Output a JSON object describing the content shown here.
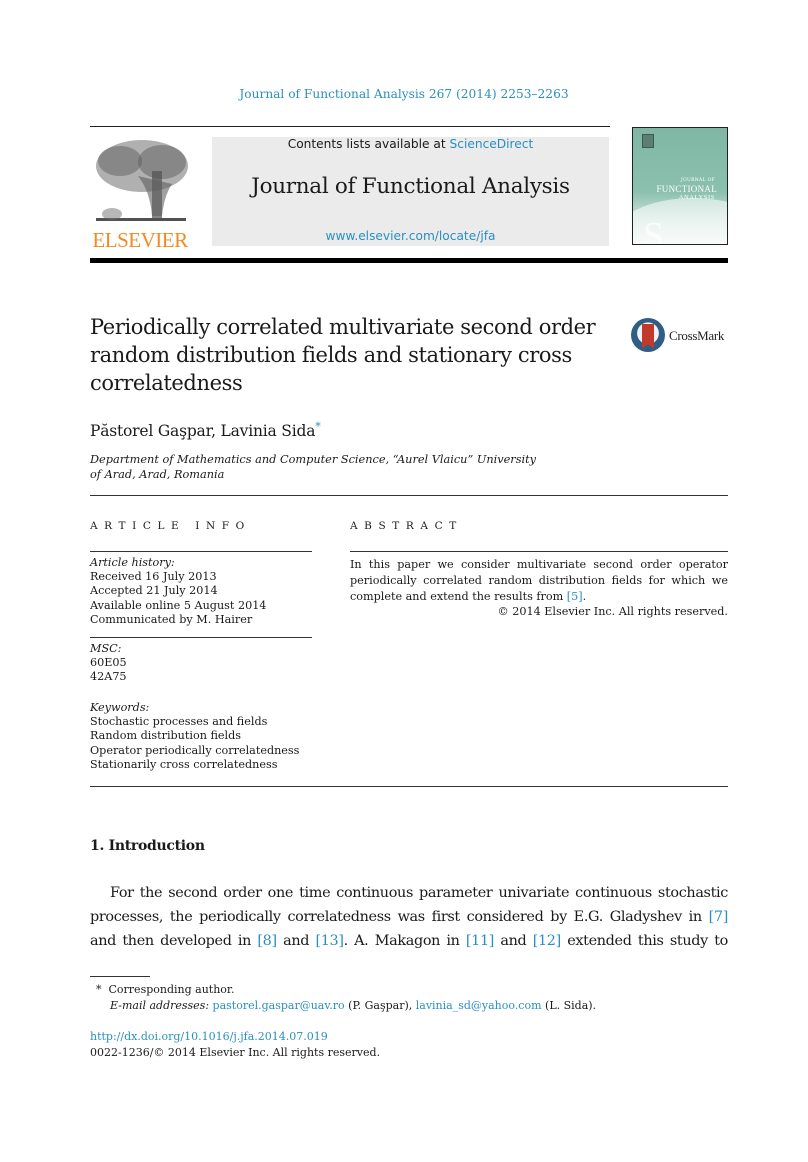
{
  "running_head": "Journal of Functional Analysis 267 (2014) 2253–2263",
  "masthead": {
    "publisher_logo": "ELSEVIER",
    "contents_prefix": "Contents lists available at ",
    "contents_link": "ScienceDirect",
    "journal_title": "Journal of Functional Analysis",
    "journal_url": "www.elsevier.com/locate/jfa",
    "cover": {
      "line1": "JOURNAL OF",
      "line2": "FUNCTIONAL",
      "line3": "ANALYSIS",
      "glyph": "S"
    }
  },
  "article": {
    "title": "Periodically correlated multivariate second order random distribution fields and stationary cross correlatedness",
    "crossmark_label": "CrossMark",
    "authors": "Păstorel Gaşpar, Lavinia Sida",
    "corresponding_mark": "*",
    "affiliation_line1": "Department of Mathematics and Computer Science, “Aurel Vlaicu” University",
    "affiliation_line2": "of Arad, Arad, Romania"
  },
  "article_info": {
    "heading": "ARTICLE INFO",
    "history_label": "Article history:",
    "history": [
      "Received 16 July 2013",
      "Accepted 21 July 2014",
      "Available online 5 August 2014",
      "Communicated by M. Hairer"
    ],
    "msc_label": "MSC:",
    "msc": [
      "60E05",
      "42A75"
    ],
    "keywords_label": "Keywords:",
    "keywords": [
      "Stochastic processes and fields",
      "Random distribution fields",
      "Operator periodically correlatedness",
      "Stationarily cross correlatedness"
    ]
  },
  "abstract": {
    "heading": "ABSTRACT",
    "text_before_ref": "In this paper we consider multivariate second order operator periodically correlated random distribution fields for which we complete and extend the results from ",
    "ref": "[5]",
    "text_after_ref": ".",
    "copyright": "© 2014 Elsevier Inc. All rights reserved."
  },
  "section": {
    "heading": "1.  Introduction",
    "lines": [
      {
        "parts": [
          {
            "t": "For the second order one time continuous parameter univariate continuous stochastic"
          }
        ]
      },
      {
        "parts": [
          {
            "t": "processes, the periodically correlatedness was first considered by E.G. Gladyshev in "
          },
          {
            "t": "[7]",
            "link": true
          }
        ]
      },
      {
        "parts": [
          {
            "t": "and then developed in "
          },
          {
            "t": "[8]",
            "link": true
          },
          {
            "t": " and "
          },
          {
            "t": "[13]",
            "link": true
          },
          {
            "t": ". A. Makagon in "
          },
          {
            "t": "[11]",
            "link": true
          },
          {
            "t": " and "
          },
          {
            "t": "[12]",
            "link": true
          },
          {
            "t": " extended this study to"
          }
        ]
      }
    ]
  },
  "footnotes": {
    "mark": "*",
    "corresponding": "Corresponding author.",
    "email_label": "E-mail addresses:",
    "email1": "pastorel.gaspar@uav.ro",
    "email1_owner": " (P. Gaşpar), ",
    "email2": "lavinia_sd@yahoo.com",
    "email2_owner": " (L. Sida).",
    "doi": "http://dx.doi.org/10.1016/j.jfa.2014.07.019",
    "issn": "0022-1236/© 2014 Elsevier Inc. All rights reserved."
  },
  "colors": {
    "link": "#2a8fc0",
    "elsevier_orange": "#f28a22",
    "masthead_gray": "#ebebeb"
  }
}
